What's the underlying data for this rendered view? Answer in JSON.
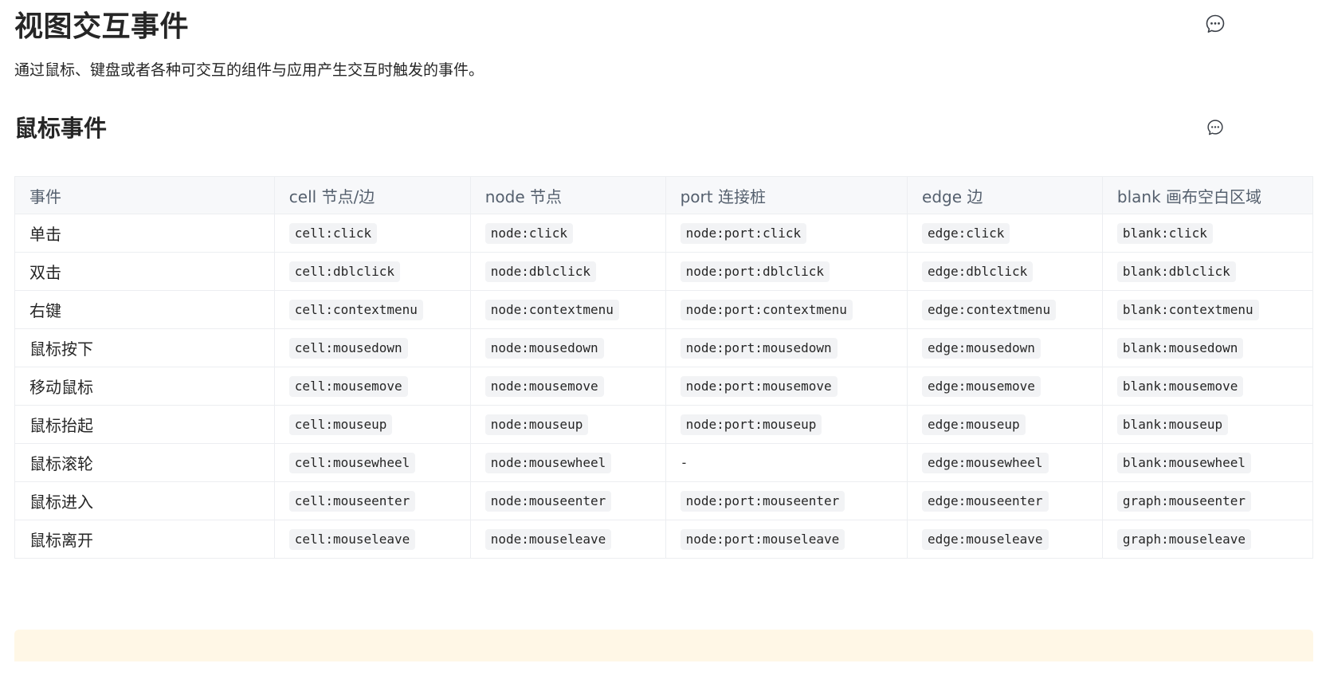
{
  "page": {
    "title": "视图交互事件",
    "description": "通过鼠标、键盘或者各种可交互的组件与应用产生交互时触发的事件。",
    "section_title": "鼠标事件",
    "comment_icon": "comment-bubble-icon"
  },
  "table": {
    "headers": [
      "事件",
      "cell 节点/边",
      "node 节点",
      "port 连接桩",
      "edge 边",
      "blank 画布空白区域"
    ],
    "rows": [
      {
        "label": "单击",
        "cells": [
          "cell:click",
          "node:click",
          "node:port:click",
          "edge:click",
          "blank:click"
        ]
      },
      {
        "label": "双击",
        "cells": [
          "cell:dblclick",
          "node:dblclick",
          "node:port:dblclick",
          "edge:dblclick",
          "blank:dblclick"
        ]
      },
      {
        "label": "右键",
        "cells": [
          "cell:contextmenu",
          "node:contextmenu",
          "node:port:contextmenu",
          "edge:contextmenu",
          "blank:contextmenu"
        ]
      },
      {
        "label": "鼠标按下",
        "cells": [
          "cell:mousedown",
          "node:mousedown",
          "node:port:mousedown",
          "edge:mousedown",
          "blank:mousedown"
        ]
      },
      {
        "label": "移动鼠标",
        "cells": [
          "cell:mousemove",
          "node:mousemove",
          "node:port:mousemove",
          "edge:mousemove",
          "blank:mousemove"
        ]
      },
      {
        "label": "鼠标抬起",
        "cells": [
          "cell:mouseup",
          "node:mouseup",
          "node:port:mouseup",
          "edge:mouseup",
          "blank:mouseup"
        ]
      },
      {
        "label": "鼠标滚轮",
        "cells": [
          "cell:mousewheel",
          "node:mousewheel",
          "-",
          "edge:mousewheel",
          "blank:mousewheel"
        ]
      },
      {
        "label": "鼠标进入",
        "cells": [
          "cell:mouseenter",
          "node:mouseenter",
          "node:port:mouseenter",
          "edge:mouseenter",
          "graph:mouseenter"
        ]
      },
      {
        "label": "鼠标离开",
        "cells": [
          "cell:mouseleave",
          "node:mouseleave",
          "node:port:mouseleave",
          "edge:mouseleave",
          "graph:mouseleave"
        ]
      }
    ]
  },
  "colors": {
    "header_bg": "#f7f8fa",
    "code_bg": "#f2f3f5",
    "tip_bg": "#fff7e6"
  }
}
